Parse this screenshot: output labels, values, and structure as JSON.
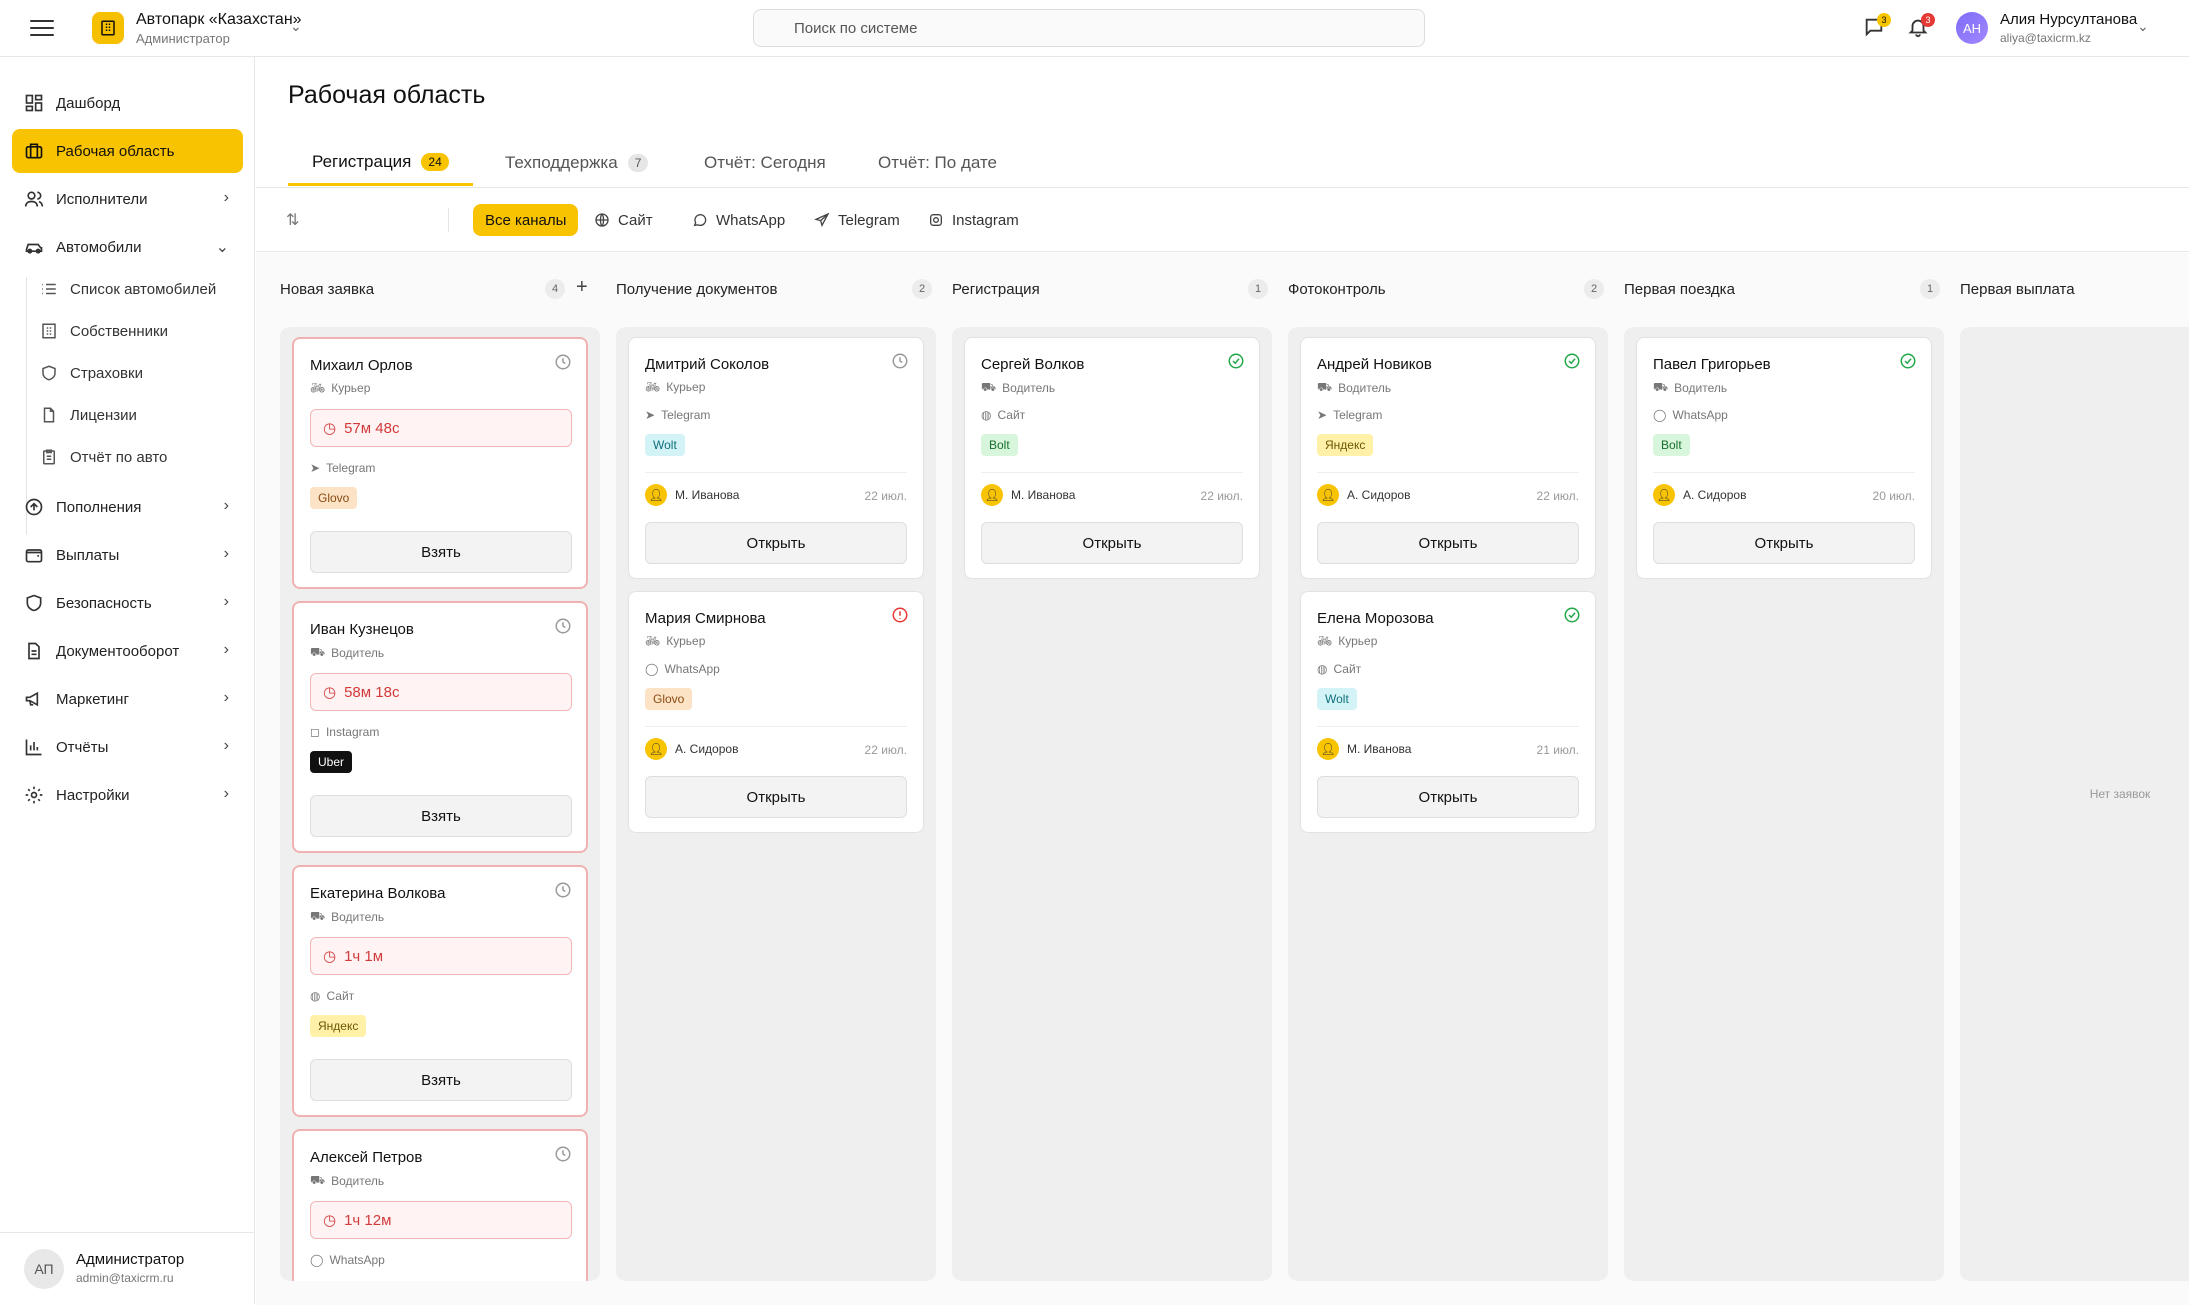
{
  "header": {
    "org_name": "Автопарк «Казахстан»",
    "org_role": "Администратор",
    "search_placeholder": "Поиск по системе",
    "messages_badge": "3",
    "notifications_badge": "3",
    "user_initials": "АН",
    "user_name": "Алия Нурсултанова",
    "user_email": "aliya@taxicrm.kz"
  },
  "sidebar": {
    "items": [
      {
        "label": "Дашборд"
      },
      {
        "label": "Рабочая область"
      },
      {
        "label": "Исполнители"
      },
      {
        "label": "Автомобили"
      },
      {
        "label": "Пополнения"
      },
      {
        "label": "Выплаты"
      },
      {
        "label": "Безопасность"
      },
      {
        "label": "Документооборот"
      },
      {
        "label": "Маркетинг"
      },
      {
        "label": "Отчёты"
      },
      {
        "label": "Настройки"
      }
    ],
    "sub_items": [
      {
        "label": "Список автомобилей"
      },
      {
        "label": "Собственники"
      },
      {
        "label": "Страховки"
      },
      {
        "label": "Лицензии"
      },
      {
        "label": "Отчёт по авто"
      }
    ],
    "footer": {
      "initials": "АП",
      "name": "Администратор",
      "email": "admin@taxicrm.ru"
    }
  },
  "main": {
    "title": "Рабочая область",
    "tabs": [
      {
        "label": "Регистрация",
        "count": "24"
      },
      {
        "label": "Техподдержка",
        "count": "7"
      },
      {
        "label": "Отчёт: Сегодня"
      },
      {
        "label": "Отчёт: По дате"
      }
    ],
    "filters": [
      {
        "label": "Все каналы"
      },
      {
        "label": "Сайт"
      },
      {
        "label": "WhatsApp"
      },
      {
        "label": "Telegram"
      },
      {
        "label": "Instagram"
      }
    ]
  },
  "board": {
    "columns": [
      {
        "title": "Новая заявка",
        "count": "4"
      },
      {
        "title": "Получение документов",
        "count": "2"
      },
      {
        "title": "Регистрация",
        "count": "1"
      },
      {
        "title": "Фотоконтроль",
        "count": "2"
      },
      {
        "title": "Первая поездка",
        "count": "1"
      },
      {
        "title": "Первая выплата",
        "empty": "Нет заявок"
      }
    ],
    "new_cards": [
      {
        "name": "Михаил Орлов",
        "role": "Курьер",
        "timer": "57м 48с",
        "channel": "Telegram",
        "tag": "Glovo",
        "button": "Взять"
      },
      {
        "name": "Иван Кузнецов",
        "role": "Водитель",
        "timer": "58м 18с",
        "channel": "Instagram",
        "tag": "Uber",
        "button": "Взять"
      },
      {
        "name": "Екатерина Волкова",
        "role": "Водитель",
        "timer": "1ч 1м",
        "channel": "Сайт",
        "tag": "Яндекс",
        "button": "Взять"
      },
      {
        "name": "Алексей Петров",
        "role": "Водитель",
        "timer": "1ч 12м",
        "channel": "WhatsApp"
      }
    ],
    "cards": [
      {
        "name": "Дмитрий Соколов",
        "role": "Курьер",
        "channel": "Telegram",
        "tag": "Wolt",
        "assignee": "М. Иванова",
        "date": "22 июл.",
        "button": "Открыть"
      },
      {
        "name": "Мария Смирнова",
        "role": "Курьер",
        "channel": "WhatsApp",
        "tag": "Glovo",
        "assignee": "А. Сидоров",
        "date": "22 июл.",
        "button": "Открыть"
      },
      {
        "name": "Сергей Волков",
        "role": "Водитель",
        "channel": "Сайт",
        "tag": "Bolt",
        "assignee": "М. Иванова",
        "date": "22 июл.",
        "button": "Открыть"
      },
      {
        "name": "Андрей Новиков",
        "role": "Водитель",
        "channel": "Telegram",
        "tag": "Яндекс",
        "assignee": "А. Сидоров",
        "date": "22 июл.",
        "button": "Открыть"
      },
      {
        "name": "Елена Морозова",
        "role": "Курьер",
        "channel": "Сайт",
        "tag": "Wolt",
        "assignee": "М. Иванова",
        "date": "21 июл.",
        "button": "Открыть"
      },
      {
        "name": "Павел Григорьев",
        "role": "Водитель",
        "channel": "WhatsApp",
        "tag": "Bolt",
        "assignee": "А. Сидоров",
        "date": "20 июл.",
        "button": "Открыть"
      }
    ]
  },
  "colors": {
    "accent": "#f8c300",
    "danger": "#d23b3b",
    "success": "#22a84a"
  }
}
